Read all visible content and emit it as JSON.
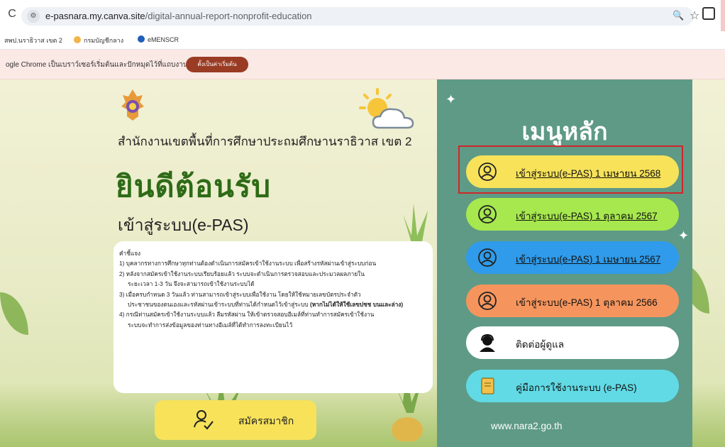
{
  "browser": {
    "url_host": "e-pasnara.my.canva.site",
    "url_path": "/digital-annual-report-nonprofit-education",
    "reload_icon": "reload-icon",
    "bookmarks": [
      {
        "label": "สพป.นราธิวาส เขต 2"
      },
      {
        "label": "กรมบัญชีกลาง"
      },
      {
        "label": "eMENSCR"
      }
    ],
    "info_bar_text": "ogle Chrome เป็นเบราว์เซอร์เริ่มต้นและปักหมุดไว้ที่แถบงาน",
    "info_bar_button": "ตั้งเป็นค่าเริ่มต้น"
  },
  "page": {
    "office_name": "สำนักงานเขตพื้นที่การศึกษาประถมศึกษานราธิวาส เขต 2",
    "welcome": "ยินดีต้อนรับ",
    "subtitle": "เข้าสู่ระบบ(e-PAS)",
    "instructions": {
      "heading": "คำชี้แจง",
      "lines": [
        "1) บุคลากรทางการศึกษาทุกท่านต้องดำเนินการสมัครเข้าใช้งานระบบ เพื่อสร้างรหัสผ่านเข้าสู่ระบบก่อน",
        "2) หลังจากสมัครเข้าใช้งานระบบเรียบร้อยแล้ว ระบบจะดำเนินการตรวจสอบและประมวลผลภายใน",
        "ระยะเวลา 1-3 วัน จึงจะสามารถเข้าใช้งานระบบได้",
        "3) เมื่อครบกำหนด 3 วันแล้ว ท่านสามารถเข้าสู่ระบบเพื่อใช้งาน โดยให้ใช้หมายเลขบัตรประจำตัว",
        "ประชาชนของตนเองและรหัสผ่านเข้าระบบที่ท่านได้กำหนดไว้เข้าสู่ระบบ",
        "4)  กรณีท่านสมัครเข้าใช้งานระบบแล้ว ลืมรหัสผ่าน ให้เข้าตรวจสอบอีเมล์ที่ท่านทำการสมัครเข้าใช้งาน",
        "ระบบจะทำการส่งข้อมูลของท่านทางอีเมล์ที่ได้ทำการลงทะเบียนไว้"
      ],
      "line5_bold": "(หากไม่ได้ให้ใช้เลขปชช บนและล่าง)"
    },
    "register_button": "สมัครสมาชิก"
  },
  "menu": {
    "title": "เมนูหลัก",
    "items": [
      {
        "label": "เข้าสู่ระบบ(e-PAS) 1 เมษายน 2568",
        "color": "#f7e25a",
        "icon": "user-circle-icon"
      },
      {
        "label": "เข้าสู่ระบบ(e-PAS) 1 ตุลาคม 2567",
        "color": "#a6e84e",
        "icon": "user-circle-icon"
      },
      {
        "label": "เข้าสู่ระบบ(e-PAS) 1 เมษายน 2567",
        "color": "#2f9bea",
        "icon": "user-circle-icon"
      },
      {
        "label": "เข้าสู่ระบบ(e-PAS)  1 ตุลาคม 2566",
        "color": "#f5955d",
        "icon": "user-circle-icon"
      },
      {
        "label": "ติดต่อผู้ดูแล",
        "color": "#ffffff",
        "icon": "support-agent-icon"
      },
      {
        "label": "คู่มือการใช้งานระบบ (e-PAS)",
        "color": "#61dae5",
        "icon": "manual-book-icon"
      }
    ],
    "website": "www.nara2.go.th"
  }
}
